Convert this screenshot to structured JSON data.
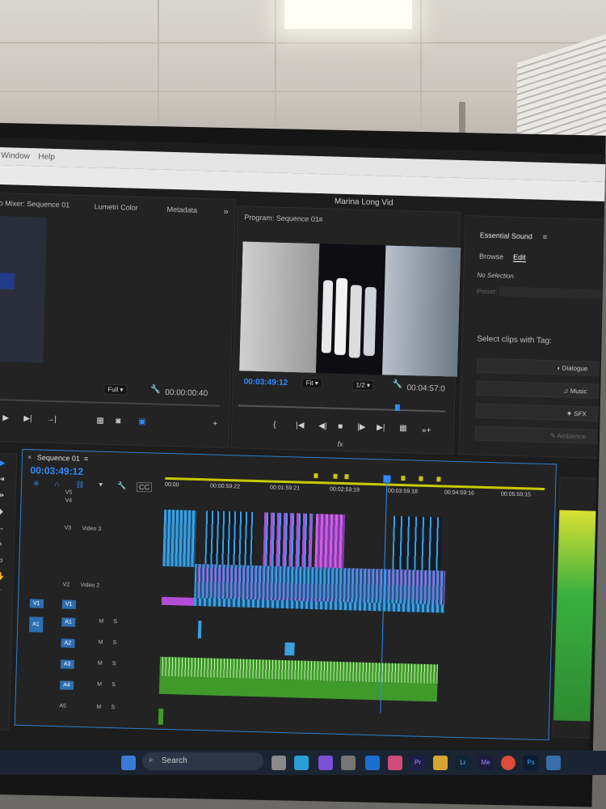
{
  "menu": {
    "window": "Window",
    "help": "Help"
  },
  "app_title": "Marina Long Vid",
  "source_panel": {
    "tabs": [
      "o Mixer: Sequence 01",
      "Lumetri Color",
      "Metadata"
    ],
    "more": "»",
    "fit": "Full",
    "timecode": "00:00:00:40"
  },
  "program_panel": {
    "title": "Program: Sequence 01",
    "timecode": "00:03:49:12",
    "fit": "Fit",
    "resolution": "1/2",
    "duration": "00:04:57:0",
    "fx": "fx"
  },
  "essential_sound": {
    "title": "Essential Sound",
    "tabs": [
      "Browse",
      "Edit"
    ],
    "no_selection": "No Selection",
    "preset": "Preset:",
    "select_label": "Select clips with Tag:",
    "tags": [
      "Dialogue",
      "Music",
      "SFX",
      "Ambience"
    ]
  },
  "timeline": {
    "title": "Sequence 01",
    "timecode": "00:03:49:12",
    "ruler": [
      "00:00",
      "00:00:59:22",
      "00:01:59:21",
      "00:02:59:19",
      "00:03:59:18",
      "00:04:59:16",
      "00:05:59:15"
    ],
    "tracks": {
      "v5": "V5",
      "v4": "V4",
      "v3": "V3",
      "video3": "Video 3",
      "v2": "V2",
      "video2": "Video 2",
      "v1": "V1",
      "v1_src": "V1",
      "a1": "A1",
      "a1_src": "A1",
      "a2": "A2",
      "a3": "A3",
      "a4": "A4",
      "a5": "A5",
      "m": "M",
      "s": "S",
      "cc": "CC"
    }
  },
  "taskbar": {
    "search": "Search",
    "apps": [
      "Pr",
      "Lr",
      "Me",
      "Ps"
    ]
  },
  "colors": {
    "accent": "#2e8cff",
    "audio": "#3f9a2a",
    "video": "#3aa0e0",
    "purple": "#b14dd6",
    "playhead_marker": "#c8c800"
  }
}
